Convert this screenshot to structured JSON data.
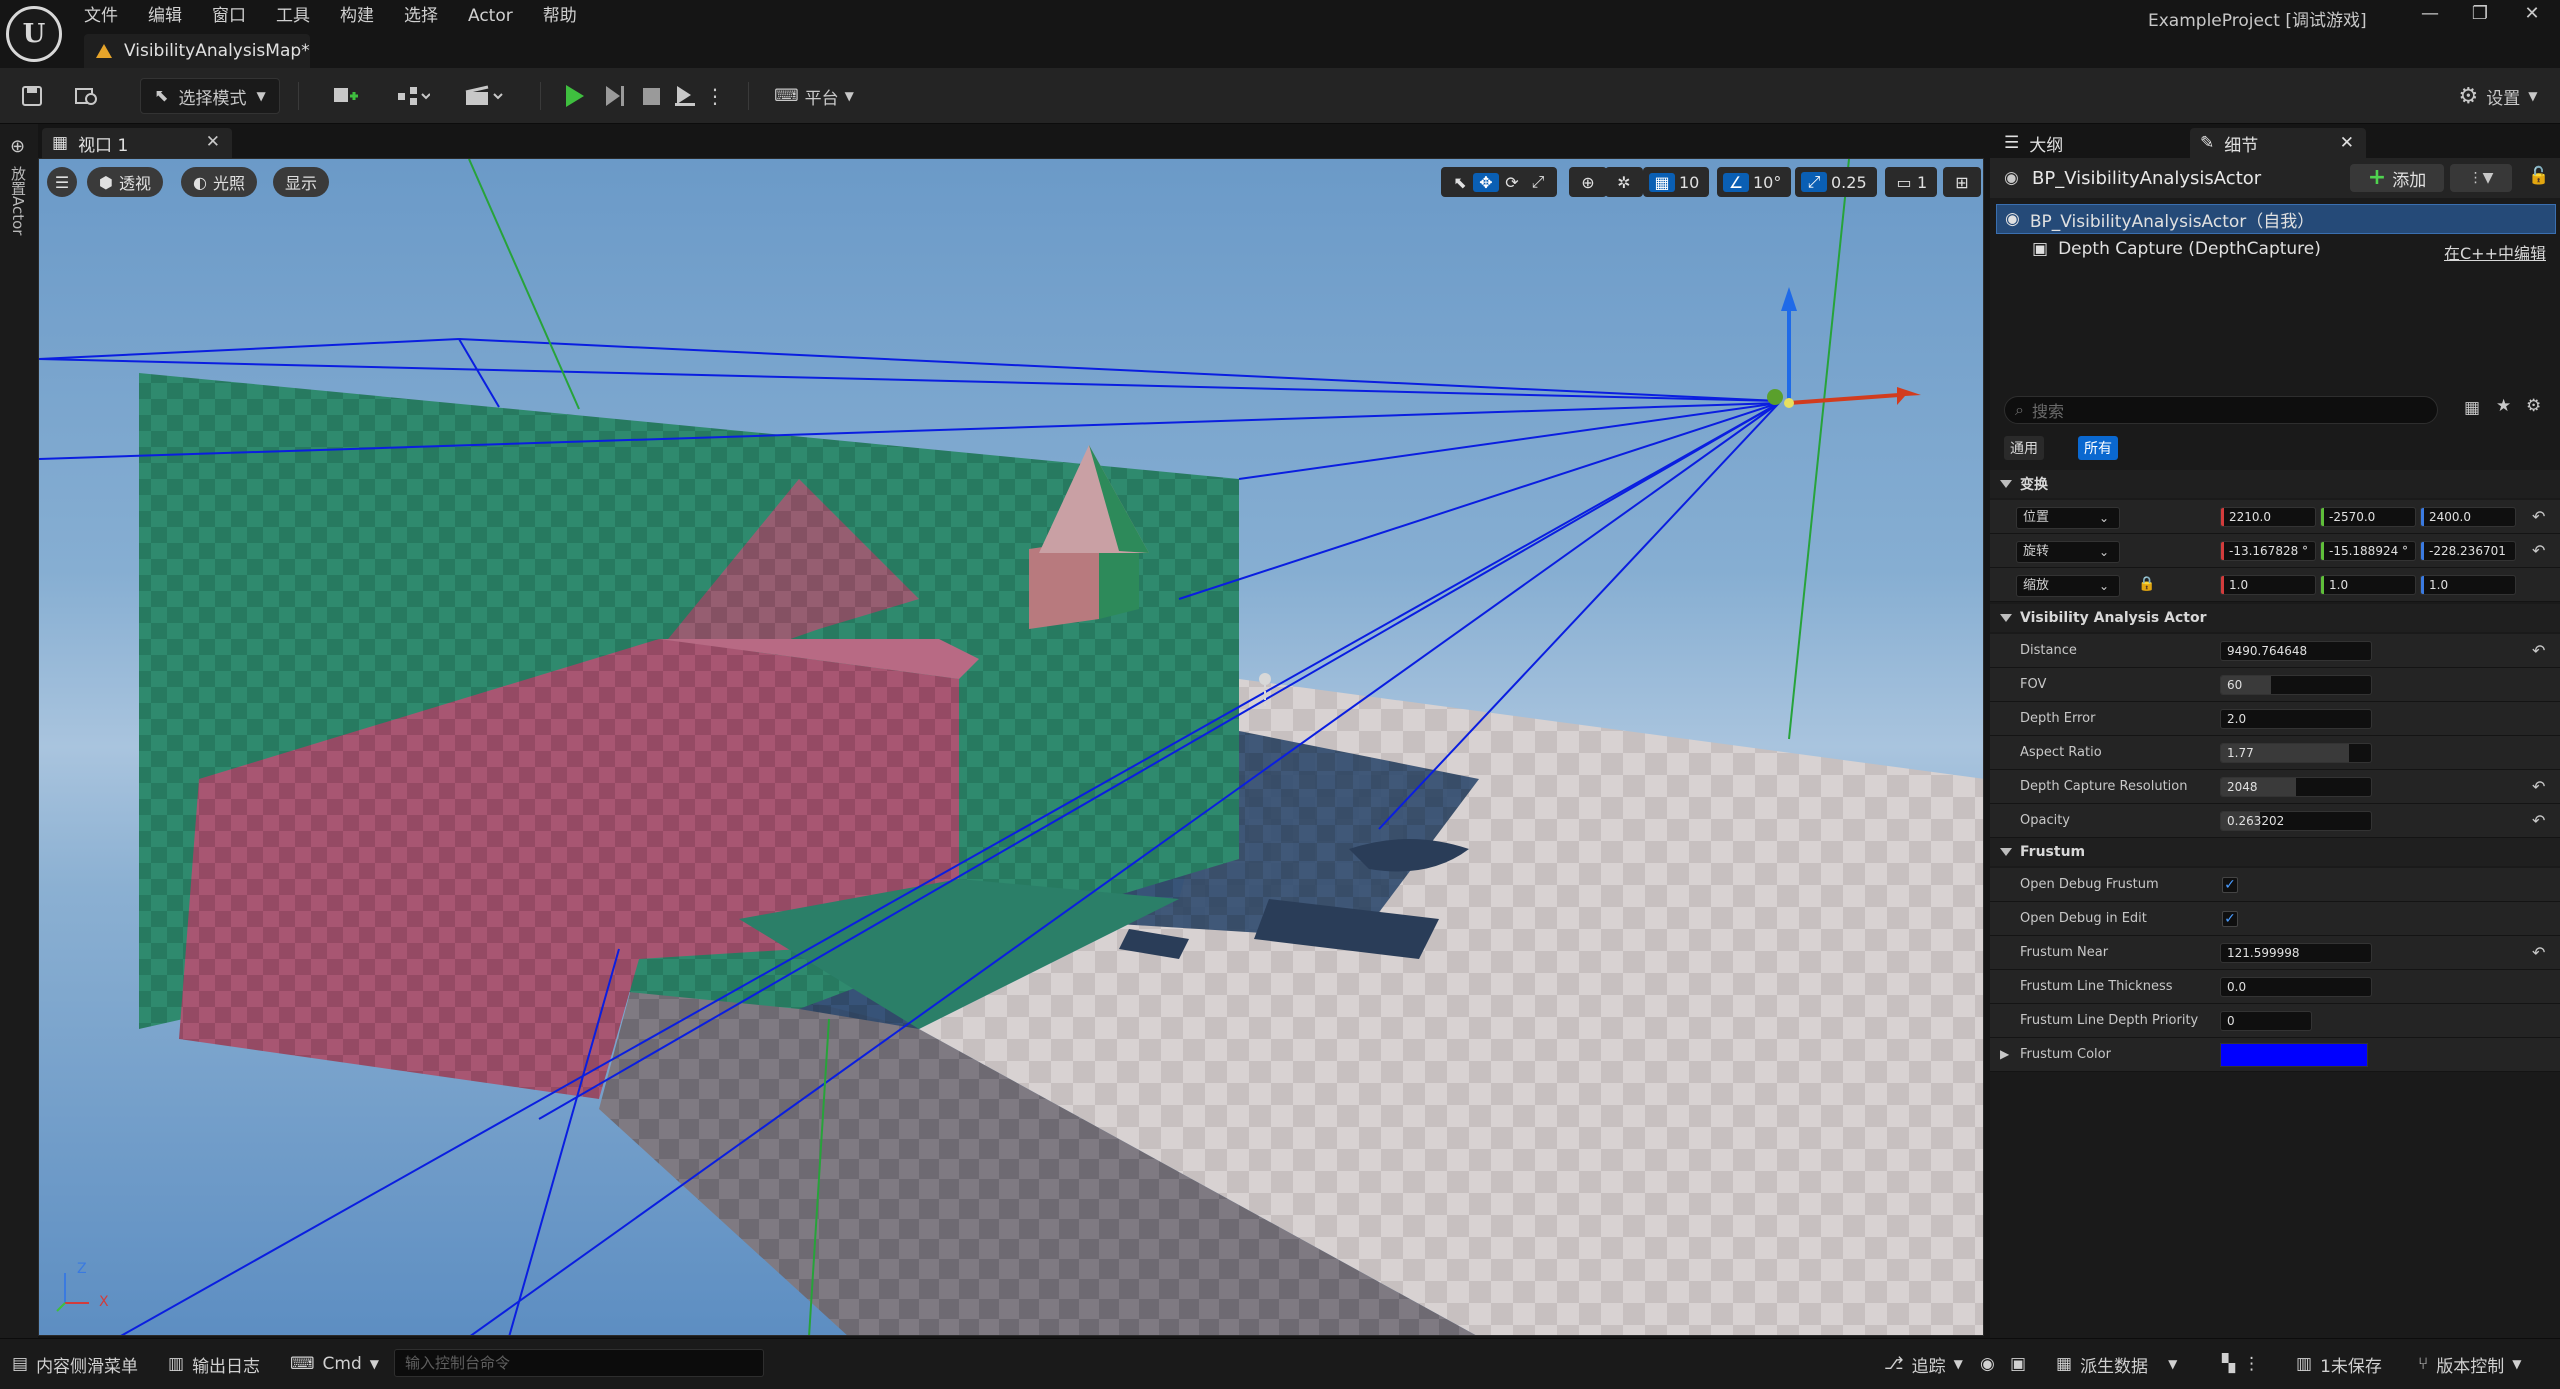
{
  "menu": [
    "文件",
    "编辑",
    "窗口",
    "工具",
    "构建",
    "选择",
    "Actor",
    "帮助"
  ],
  "map_tab": "VisibilityAnalysisMap*",
  "project_title": "ExampleProject [调试游戏]",
  "toolbar": {
    "select_mode": "选择模式",
    "platform": "平台",
    "settings": "设置"
  },
  "left_strip_label": "放置Actor",
  "viewport": {
    "tab_label": "视口 1",
    "perspective": "透视",
    "lit": "光照",
    "show": "显示",
    "grid_snap": "10",
    "rot_snap": "10°",
    "scale_snap": "0.25",
    "camera_speed": "1",
    "axis_z": "Z",
    "axis_x": "X"
  },
  "panel": {
    "outliner_tab": "大纲",
    "details_tab": "细节",
    "actor_name": "BP_VisibilityAnalysisActor",
    "add_label": "添加",
    "tree_self": "BP_VisibilityAnalysisActor（自我）",
    "tree_component": "Depth Capture (DepthCapture)",
    "edit_in_cpp": "在C++中编辑",
    "search_placeholder": "搜索",
    "filter_general": "通用",
    "filter_all": "所有"
  },
  "transform": {
    "header": "变换",
    "location_label": "位置",
    "rotation_label": "旋转",
    "scale_label": "缩放",
    "location": [
      "2210.0",
      "-2570.0",
      "2400.0"
    ],
    "rotation": [
      "-13.167828 °",
      "-15.188924 °",
      "-228.236701 °"
    ],
    "scale": [
      "1.0",
      "1.0",
      "1.0"
    ]
  },
  "visibility": {
    "header": "Visibility Analysis Actor",
    "distance_label": "Distance",
    "distance": "9490.764648",
    "fov_label": "FOV",
    "fov": "60",
    "fov_fill": 0.33,
    "depth_error_label": "Depth Error",
    "depth_error": "2.0",
    "aspect_label": "Aspect Ratio",
    "aspect": "1.77",
    "aspect_fill": 0.85,
    "resolution_label": "Depth Capture Resolution",
    "resolution": "2048",
    "resolution_fill": 0.5,
    "opacity_label": "Opacity",
    "opacity": "0.263202",
    "opacity_fill": 0.26
  },
  "frustum": {
    "header": "Frustum",
    "open_debug_label": "Open Debug Frustum",
    "open_edit_label": "Open Debug in Edit",
    "near_label": "Frustum Near",
    "near": "121.599998",
    "thickness_label": "Frustum Line Thickness",
    "thickness": "0.0",
    "priority_label": "Frustum Line Depth Priority",
    "priority": "0",
    "color_label": "Frustum Color",
    "color": "#0000ff"
  },
  "statusbar": {
    "content_drawer": "内容侧滑菜单",
    "output_log": "输出日志",
    "cmd": "Cmd",
    "cmd_placeholder": "输入控制台命令",
    "trace": "追踪",
    "derived_data": "派生数据",
    "unsaved": "1未保存",
    "source_control": "版本控制"
  }
}
